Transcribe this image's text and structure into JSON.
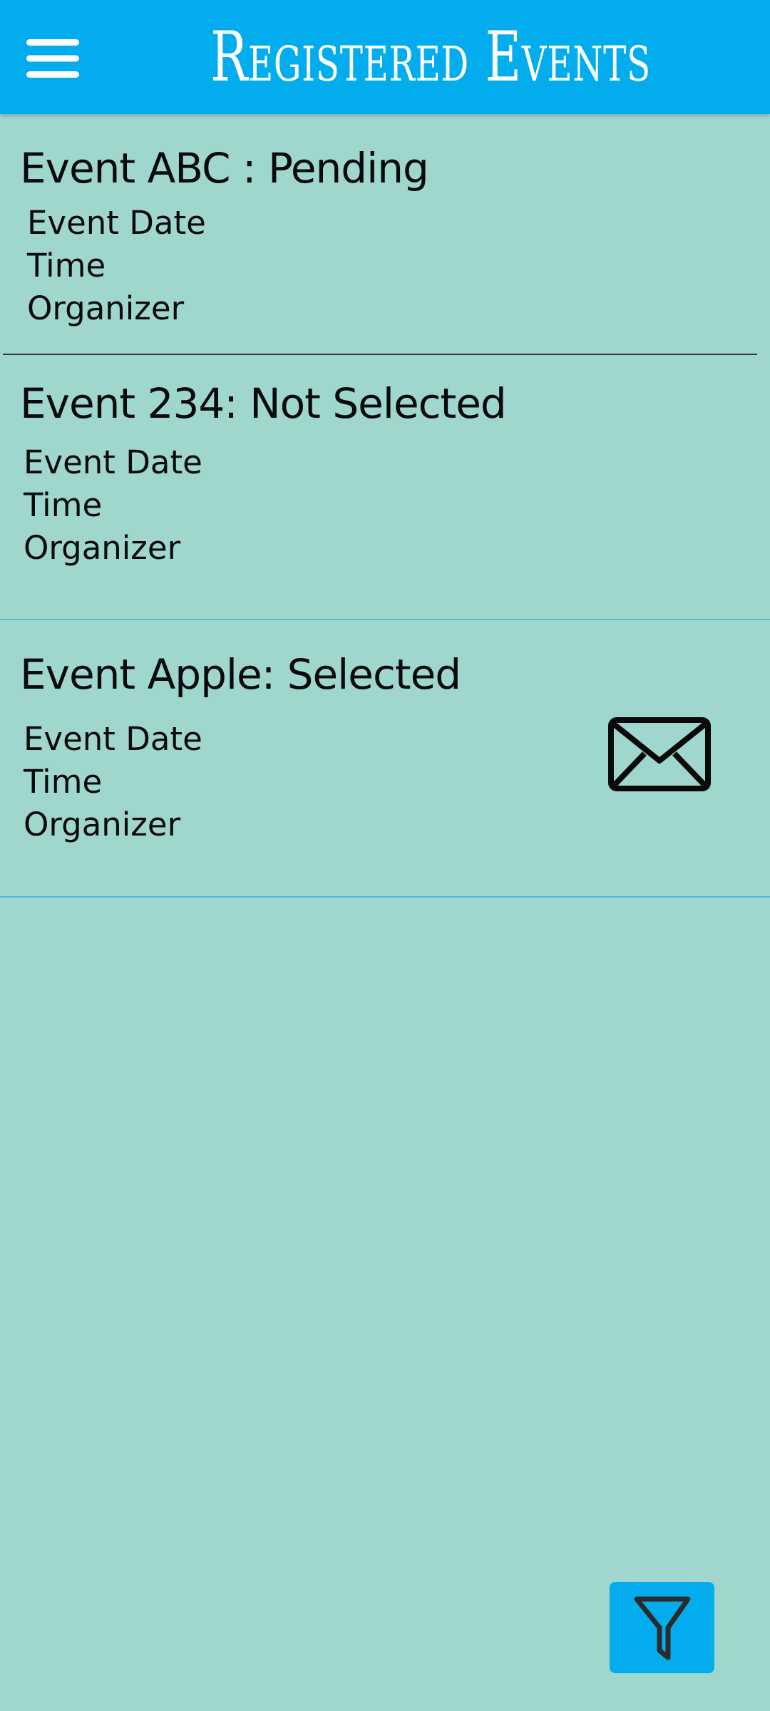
{
  "header": {
    "title": "Registered Events",
    "menu_icon": "hamburger-menu-icon"
  },
  "events": [
    {
      "name": "Event ABC : Pending",
      "date_label": "Event Date",
      "time_label": "Time",
      "organizer_label": "Organizer"
    },
    {
      "name": "Event 234: Not Selected",
      "date_label": "Event Date",
      "time_label": "Time",
      "organizer_label": "Organizer"
    },
    {
      "name": "Event Apple: Selected",
      "date_label": "Event Date",
      "time_label": "Time",
      "organizer_label": "Organizer",
      "action_icon": "envelope-icon"
    }
  ],
  "fab": {
    "icon": "filter-icon"
  },
  "colors": {
    "header_bg": "#03aced",
    "page_bg": "#9fd7ce",
    "text": "#0a0a0a",
    "divider_dark": "#3a3a3a",
    "divider_light": "#4fb9d6"
  }
}
